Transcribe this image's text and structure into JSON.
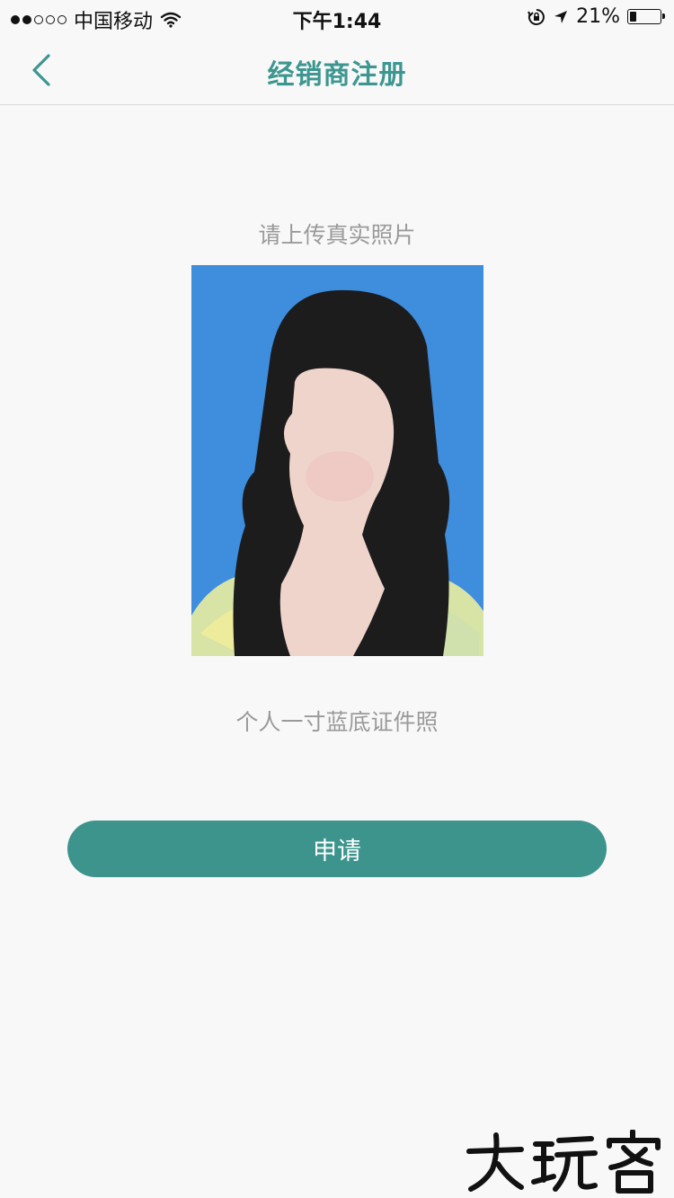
{
  "status_bar": {
    "carrier": "中国移动",
    "time": "下午1:44",
    "battery_percent": "21%",
    "battery_level": 0.21,
    "signal_bars_filled": 2,
    "signal_bars_total": 5
  },
  "nav": {
    "title": "经销商注册",
    "back_icon": "chevron-left-icon"
  },
  "content": {
    "upload_prompt": "请上传真实照片",
    "photo_caption": "个人一寸蓝底证件照",
    "apply_label": "申请"
  },
  "watermark": {
    "text": "大玩客"
  },
  "colors": {
    "accent": "#3d9690",
    "button": "#3c948d",
    "photo_background": "#3f8ddd",
    "muted_text": "#9a9a9a"
  }
}
